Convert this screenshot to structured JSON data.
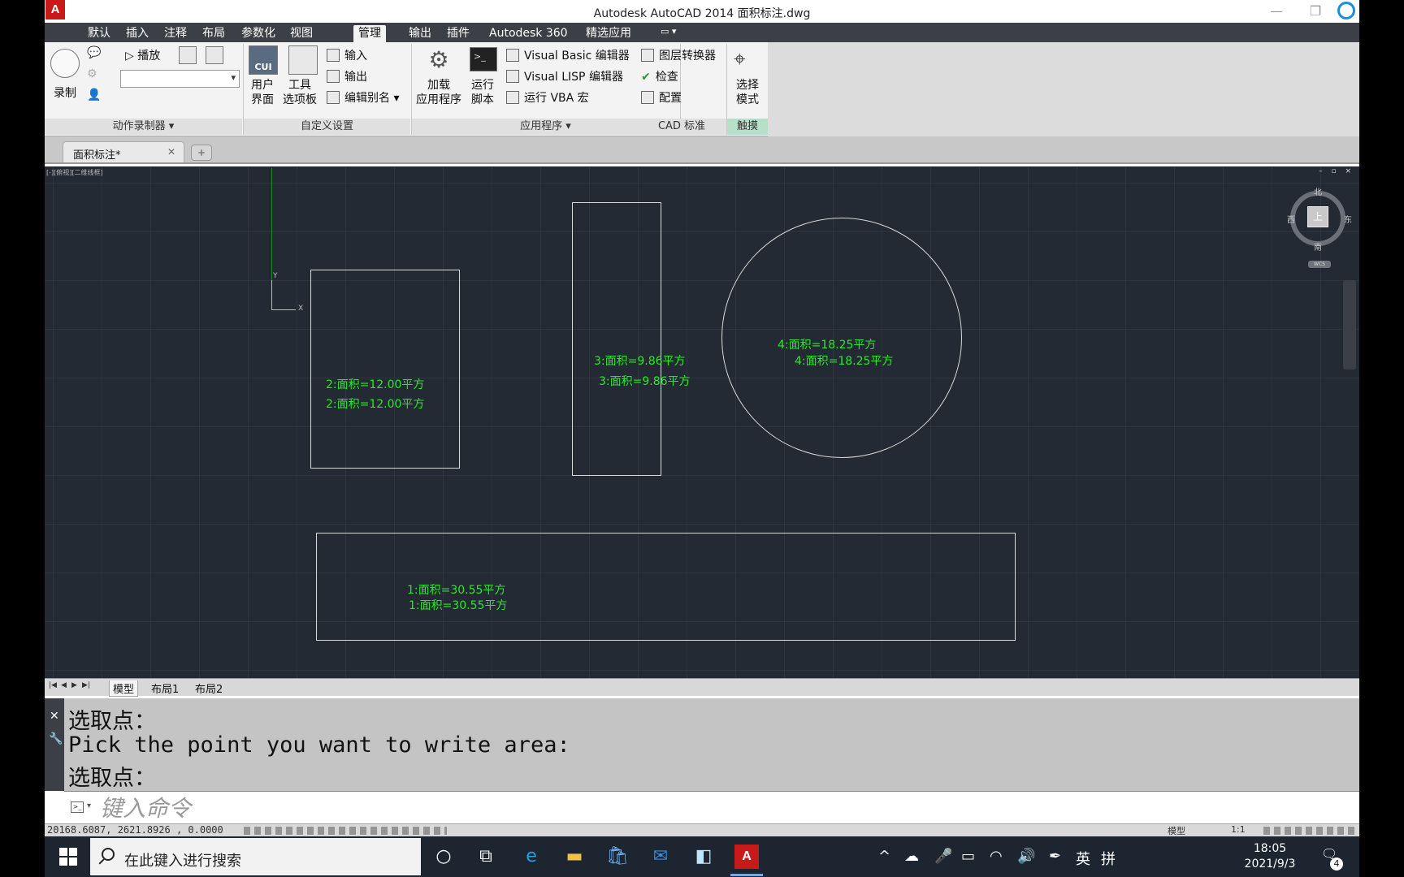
{
  "window": {
    "title": "Autodesk AutoCAD 2014    面积标注.dwg",
    "app_logo": "A"
  },
  "ribbon_tabs": [
    "默认",
    "插入",
    "注释",
    "布局",
    "参数化",
    "视图",
    "管理",
    "输出",
    "插件",
    "Autodesk 360",
    "精选应用"
  ],
  "active_tab": "管理",
  "ribbon": {
    "action_recorder": {
      "record_label": "录制",
      "play_label": "播放",
      "panel_title": "动作录制器 ▾"
    },
    "customization": {
      "user_interface_label_1": "用户",
      "user_interface_label_2": "界面",
      "tool_palettes_label_1": "工具",
      "tool_palettes_label_2": "选项板",
      "import_label": "输入",
      "export_label": "输出",
      "edit_aliases_label": "编辑别名",
      "cui_icon_text": "CUI",
      "panel_title": "自定义设置"
    },
    "applications": {
      "load_app_label_1": "加载",
      "load_app_label_2": "应用程序",
      "run_script_label_1": "运行",
      "run_script_label_2": "脚本",
      "vba_editor_label": "Visual Basic 编辑器",
      "vlisp_editor_label": "Visual LISP 编辑器",
      "run_vba_label": "运行 VBA 宏",
      "panel_title": "应用程序 ▾"
    },
    "cad_standards": {
      "layer_translator_label": "图层转换器",
      "check_label": "检查",
      "configure_label": "配置",
      "panel_title": "CAD 标准"
    },
    "touch": {
      "select_mode_label_1": "选择",
      "select_mode_label_2": "模式",
      "panel_title": "触摸"
    }
  },
  "document_tab": {
    "label": "面积标注*",
    "close": "✕",
    "new_tab": "+"
  },
  "viewport": {
    "label": "[-][俯视][二维线框]",
    "controls": "– ▫ ×",
    "ucs_y": "Y",
    "ucs_x": "X",
    "viewcube": {
      "north": "北",
      "south": "南",
      "east": "东",
      "west": "西",
      "top": "上",
      "wcs": "WCS"
    },
    "annotations": [
      {
        "text": "2:面积=12.00平方"
      },
      {
        "text": "2:面积=12.00平方"
      },
      {
        "text": "3:面积=9.86平方"
      },
      {
        "text": "3:面积=9.86平方"
      },
      {
        "text": "4:面积=18.25平方"
      },
      {
        "text": "4:面积=18.25平方"
      },
      {
        "text": "1:面积=30.55平方"
      },
      {
        "text": "1:面积=30.55平方"
      }
    ]
  },
  "layout_tabs": [
    "模型",
    "布局1",
    "布局2"
  ],
  "active_layout": "模型",
  "command_history": [
    "选取点：",
    "Pick the point you want to write area:",
    "选取点："
  ],
  "command_input_placeholder": "键入命令",
  "status_bar": {
    "coordinates": "20168.6087, 2621.8926 , 0.0000",
    "model": "模型",
    "scale": "1:1"
  },
  "taskbar": {
    "search_placeholder": "在此键入进行搜索",
    "ime_lang": "英",
    "ime_mode": "拼",
    "time": "18:05",
    "date": "2021/9/3",
    "notifications": "4"
  }
}
